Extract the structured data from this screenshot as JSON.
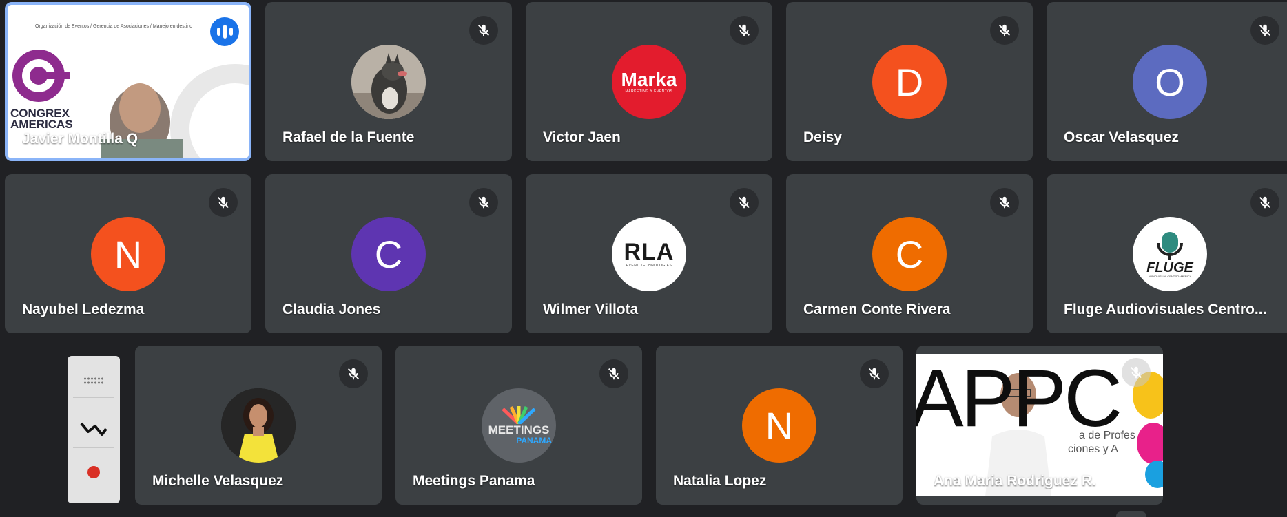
{
  "participants": [
    {
      "name": "Javier Montilla Q",
      "type": "video",
      "speaking": true,
      "muted": false,
      "video": {
        "banner": "Organización de Eventos / Gerencia de Asociaciones / Manejo en destino",
        "logo_line1": "CONGREX",
        "logo_line2": "AMERICAS"
      }
    },
    {
      "name": "Rafael de la Fuente",
      "type": "photo",
      "muted": true,
      "avatar_desc": "dog-photo"
    },
    {
      "name": "Victor Jaen",
      "type": "logo",
      "muted": true,
      "logo_text": "Marka",
      "logo_sub": "MARKETING Y EVENTOS",
      "color": "#e31c2d"
    },
    {
      "name": "Deisy",
      "type": "initial",
      "muted": true,
      "initial": "D",
      "color": "#f4511e"
    },
    {
      "name": "Oscar Velasquez",
      "type": "initial",
      "muted": true,
      "initial": "O",
      "color": "#5c6bc0"
    },
    {
      "name": "Nayubel Ledezma",
      "type": "initial",
      "muted": true,
      "initial": "N",
      "color": "#f4511e"
    },
    {
      "name": "Claudia Jones",
      "type": "initial",
      "muted": true,
      "initial": "C",
      "color": "#5e35b1"
    },
    {
      "name": "Wilmer Villota",
      "type": "logo",
      "muted": true,
      "logo_text": "RLA",
      "logo_sub": "EVENT TECHNOLOGIES",
      "color": "#ffffff"
    },
    {
      "name": "Carmen Conte Rivera",
      "type": "initial",
      "muted": true,
      "initial": "C",
      "color": "#ef6c00"
    },
    {
      "name": "Fluge Audiovisuales Centro...",
      "type": "logo",
      "muted": true,
      "logo_text": "FLUGE",
      "logo_sub": "AUDIOVISUAL CENTROAMERICA",
      "color": "#ffffff"
    },
    {
      "name": "Michelle Velasquez",
      "type": "photo",
      "muted": true,
      "avatar_desc": "woman-photo"
    },
    {
      "name": "Meetings Panama",
      "type": "logo",
      "muted": true,
      "logo_text": "MEETINGS",
      "logo_sub": "PANAMA",
      "color": "#5f6368"
    },
    {
      "name": "Natalia Lopez",
      "type": "initial",
      "muted": true,
      "initial": "N",
      "color": "#ef6c00"
    },
    {
      "name": "Ana Maria Rodriguez R.",
      "type": "video",
      "muted": true,
      "video": {
        "big_text": "APPC",
        "caption1": "a de Profes",
        "caption2": "ciones y A"
      }
    }
  ],
  "toolbar": {
    "icons": [
      "drag-handle-icon",
      "chart-line-icon",
      "record-icon"
    ]
  },
  "colors": {
    "background": "#202124",
    "tile": "#3c4043",
    "accent": "#8ab4f8",
    "speaking": "#1a73e8"
  }
}
